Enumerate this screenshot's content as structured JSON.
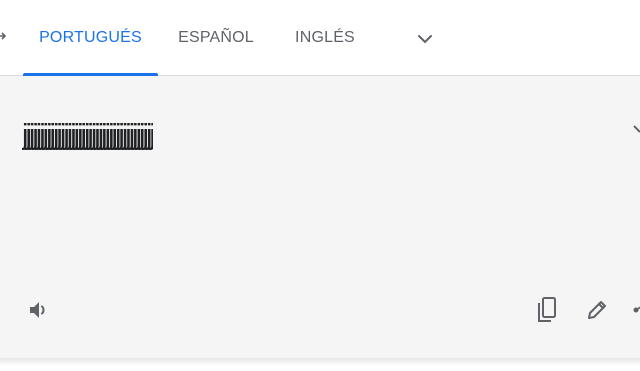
{
  "tabs": [
    {
      "label": "PORTUGUÉS",
      "active": true
    },
    {
      "label": "ESPAÑOL",
      "active": false
    },
    {
      "label": "INGLÉS",
      "active": false
    }
  ],
  "source_text": "jjjjjjjjjjjjjjjjjjjjjjjjjjjjjjjjjjjjjj",
  "icons": {
    "swap": "swap-arrows-icon",
    "dropdown": "chevron-down-icon",
    "clear": "close-icon",
    "listen": "speaker-icon",
    "copy": "copy-icon",
    "edit": "pencil-icon",
    "share": "share-icon"
  },
  "colors": {
    "accent": "#1a73e8",
    "tab_text": "#5f6368",
    "panel_bg": "#f5f5f5",
    "text": "#202124",
    "icon": "#5f6368"
  }
}
